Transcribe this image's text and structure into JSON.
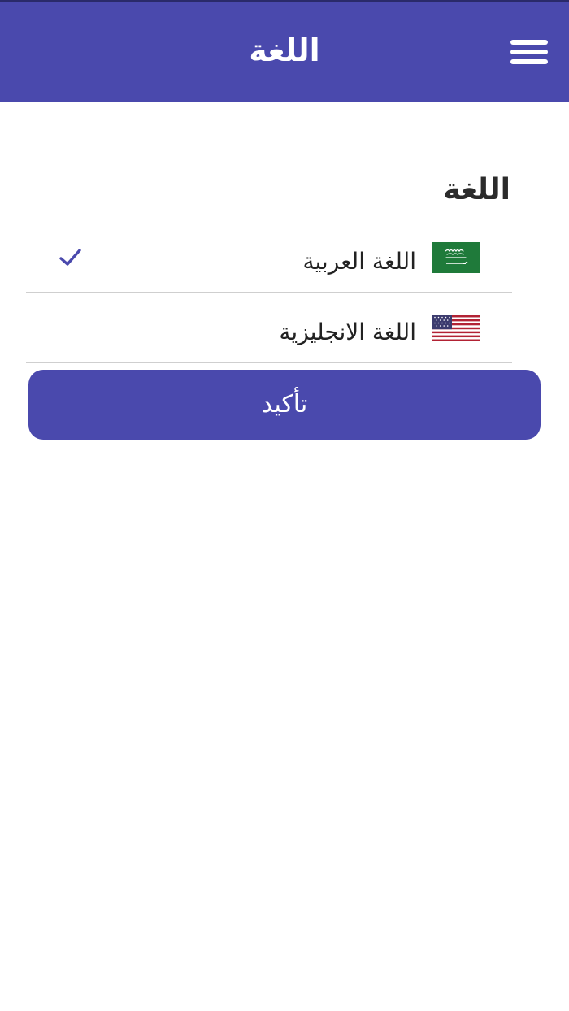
{
  "header": {
    "title": "اللغة",
    "menu_icon": "hamburger-menu-icon",
    "background_color": "#4a49ad"
  },
  "content": {
    "heading": "اللغة",
    "languages": [
      {
        "label": "اللغة العربية",
        "flag_icon": "saudi-flag-icon",
        "selected": true
      },
      {
        "label": "اللغة الانجليزية",
        "flag_icon": "usa-flag-icon",
        "selected": false
      }
    ],
    "selected_indicator_icon": "checkmark-icon",
    "accent_color": "#4a49ad"
  },
  "actions": {
    "confirm_label": "تأكيد"
  }
}
